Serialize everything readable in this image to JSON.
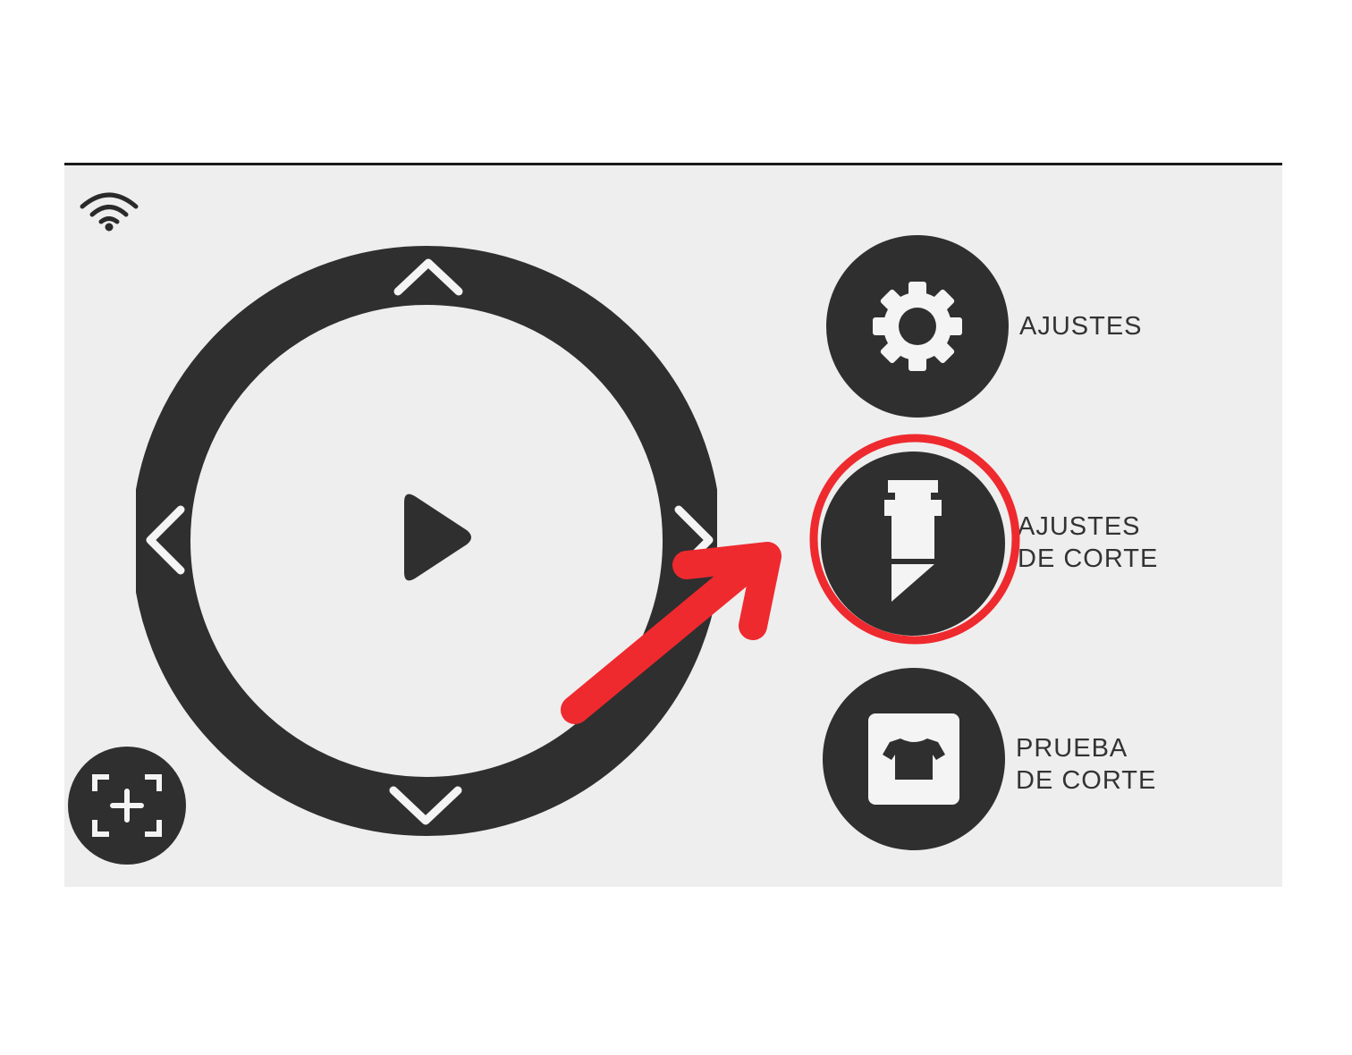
{
  "status": {
    "wifi_icon": "wifi-icon"
  },
  "dpad": {
    "up_icon": "chevron-up-icon",
    "down_icon": "chevron-down-icon",
    "left_icon": "chevron-left-icon",
    "right_icon": "chevron-right-icon",
    "center_icon": "play-icon"
  },
  "menu": {
    "settings": {
      "label": "AJUSTES",
      "icon": "gear-icon"
    },
    "cut_settings": {
      "label_line1": "AJUSTES",
      "label_line2": "DE CORTE",
      "icon": "blade-holder-icon"
    },
    "cut_test": {
      "label_line1": "PRUEBA",
      "label_line2": "DE CORTE",
      "icon": "tshirt-icon"
    }
  },
  "focus_button": {
    "icon": "crosshair-add-icon"
  },
  "annotation": {
    "color": "#ee2a2f",
    "highlight_target": "cut_settings"
  },
  "colors": {
    "screen_bg": "#eeeeee",
    "dark": "#2f2f2f"
  }
}
